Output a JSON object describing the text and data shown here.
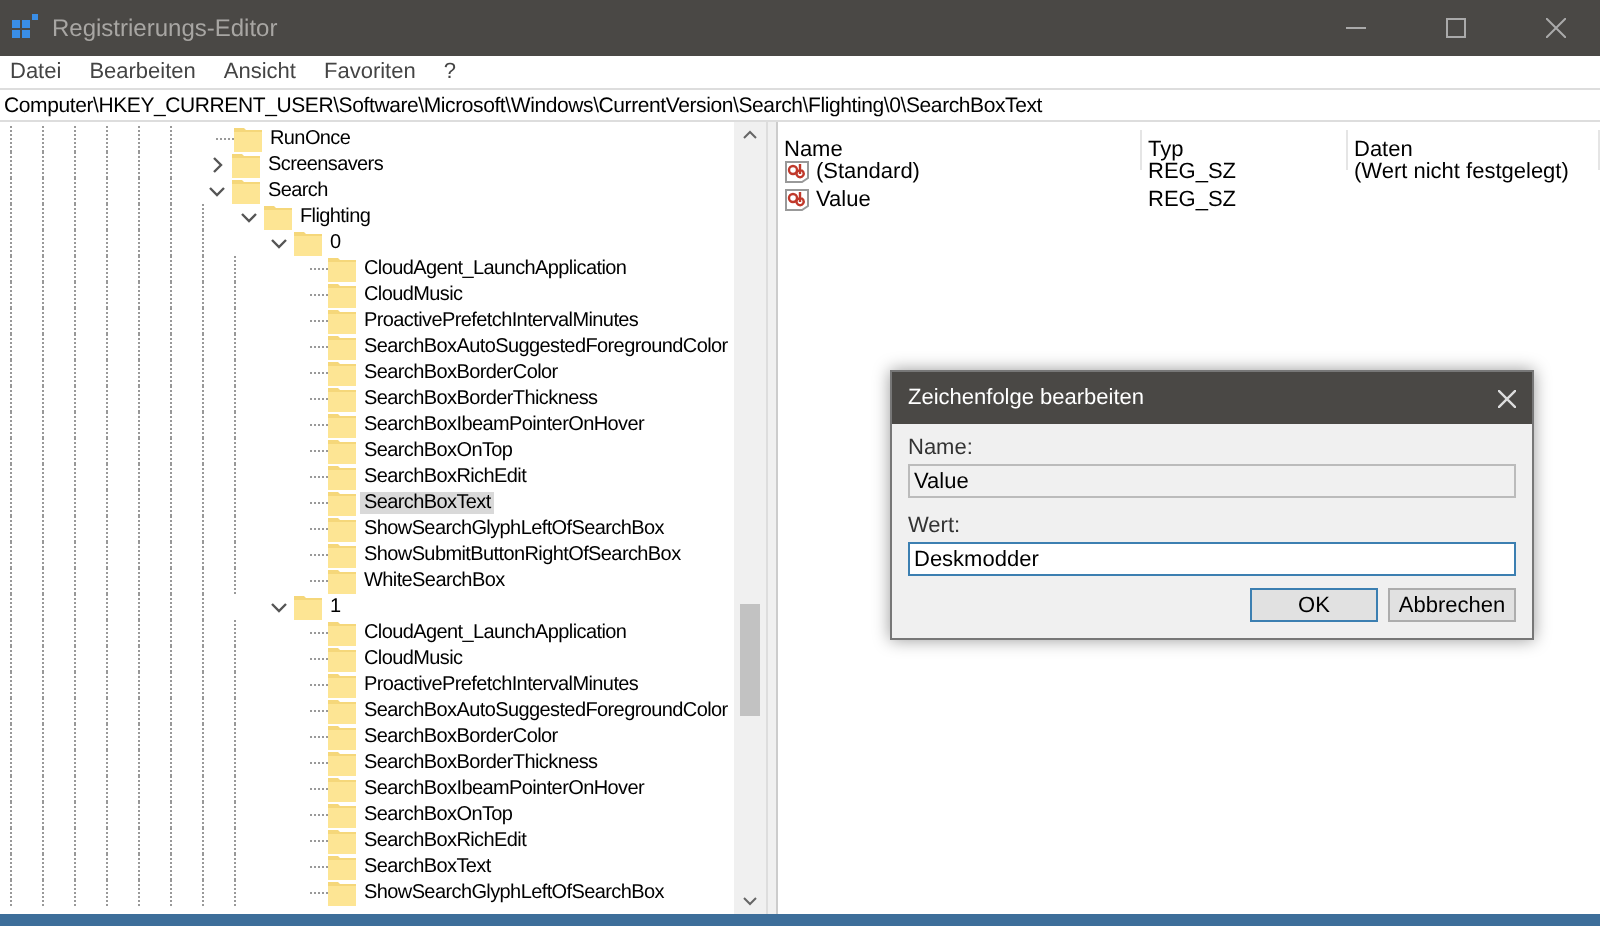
{
  "window": {
    "title": "Registrierungs-Editor"
  },
  "menu": [
    "Datei",
    "Bearbeiten",
    "Ansicht",
    "Favoriten",
    "?"
  ],
  "address": "Computer\\HKEY_CURRENT_USER\\Software\\Microsoft\\Windows\\CurrentVersion\\Search\\Flighting\\0\\SearchBoxText",
  "tree": [
    {
      "label": "RunOnce",
      "kind": "leaf",
      "selected": false
    },
    {
      "label": "Screensavers",
      "kind": "branch",
      "expanded": false,
      "selected": false
    },
    {
      "label": "Search",
      "kind": "branch",
      "expanded": true,
      "selected": false,
      "children": [
        {
          "label": "Flighting",
          "kind": "branch",
          "expanded": true,
          "selected": false,
          "children": [
            {
              "label": "0",
              "kind": "branch",
              "expanded": true,
              "selected": false,
              "children": [
                {
                  "label": "CloudAgent_LaunchApplication",
                  "kind": "leaf",
                  "selected": false
                },
                {
                  "label": "CloudMusic",
                  "kind": "leaf",
                  "selected": false
                },
                {
                  "label": "ProactivePrefetchIntervalMinutes",
                  "kind": "leaf",
                  "selected": false
                },
                {
                  "label": "SearchBoxAutoSuggestedForegroundColor",
                  "kind": "leaf",
                  "selected": false
                },
                {
                  "label": "SearchBoxBorderColor",
                  "kind": "leaf",
                  "selected": false
                },
                {
                  "label": "SearchBoxBorderThickness",
                  "kind": "leaf",
                  "selected": false
                },
                {
                  "label": "SearchBoxIbeamPointerOnHover",
                  "kind": "leaf",
                  "selected": false
                },
                {
                  "label": "SearchBoxOnTop",
                  "kind": "leaf",
                  "selected": false
                },
                {
                  "label": "SearchBoxRichEdit",
                  "kind": "leaf",
                  "selected": false
                },
                {
                  "label": "SearchBoxText",
                  "kind": "leaf",
                  "selected": true
                },
                {
                  "label": "ShowSearchGlyphLeftOfSearchBox",
                  "kind": "leaf",
                  "selected": false
                },
                {
                  "label": "ShowSubmitButtonRightOfSearchBox",
                  "kind": "leaf",
                  "selected": false
                },
                {
                  "label": "WhiteSearchBox",
                  "kind": "leaf",
                  "selected": false
                }
              ]
            },
            {
              "label": "1",
              "kind": "branch",
              "expanded": true,
              "selected": false,
              "children": [
                {
                  "label": "CloudAgent_LaunchApplication",
                  "kind": "leaf",
                  "selected": false
                },
                {
                  "label": "CloudMusic",
                  "kind": "leaf",
                  "selected": false
                },
                {
                  "label": "ProactivePrefetchIntervalMinutes",
                  "kind": "leaf",
                  "selected": false
                },
                {
                  "label": "SearchBoxAutoSuggestedForegroundColor",
                  "kind": "leaf",
                  "selected": false
                },
                {
                  "label": "SearchBoxBorderColor",
                  "kind": "leaf",
                  "selected": false
                },
                {
                  "label": "SearchBoxBorderThickness",
                  "kind": "leaf",
                  "selected": false
                },
                {
                  "label": "SearchBoxIbeamPointerOnHover",
                  "kind": "leaf",
                  "selected": false
                },
                {
                  "label": "SearchBoxOnTop",
                  "kind": "leaf",
                  "selected": false
                },
                {
                  "label": "SearchBoxRichEdit",
                  "kind": "leaf",
                  "selected": false
                },
                {
                  "label": "SearchBoxText",
                  "kind": "leaf",
                  "selected": false
                },
                {
                  "label": "ShowSearchGlyphLeftOfSearchBox",
                  "kind": "leaf",
                  "selected": false
                }
              ]
            }
          ]
        }
      ]
    }
  ],
  "table": {
    "columns": [
      "Name",
      "Typ",
      "Daten"
    ],
    "rows": [
      {
        "name": "(Standard)",
        "type": "REG_SZ",
        "data": "(Wert nicht festgelegt)"
      },
      {
        "name": "Value",
        "type": "REG_SZ"
      }
    ]
  },
  "dialog": {
    "title": "Zeichenfolge bearbeiten",
    "name_label": "Name:",
    "name_value": "Value",
    "value_label": "Wert:",
    "value": "Deskmodder",
    "buttons": [
      {
        "label": "OK",
        "default": true
      },
      {
        "label": "Abbrechen",
        "default": false
      }
    ]
  }
}
